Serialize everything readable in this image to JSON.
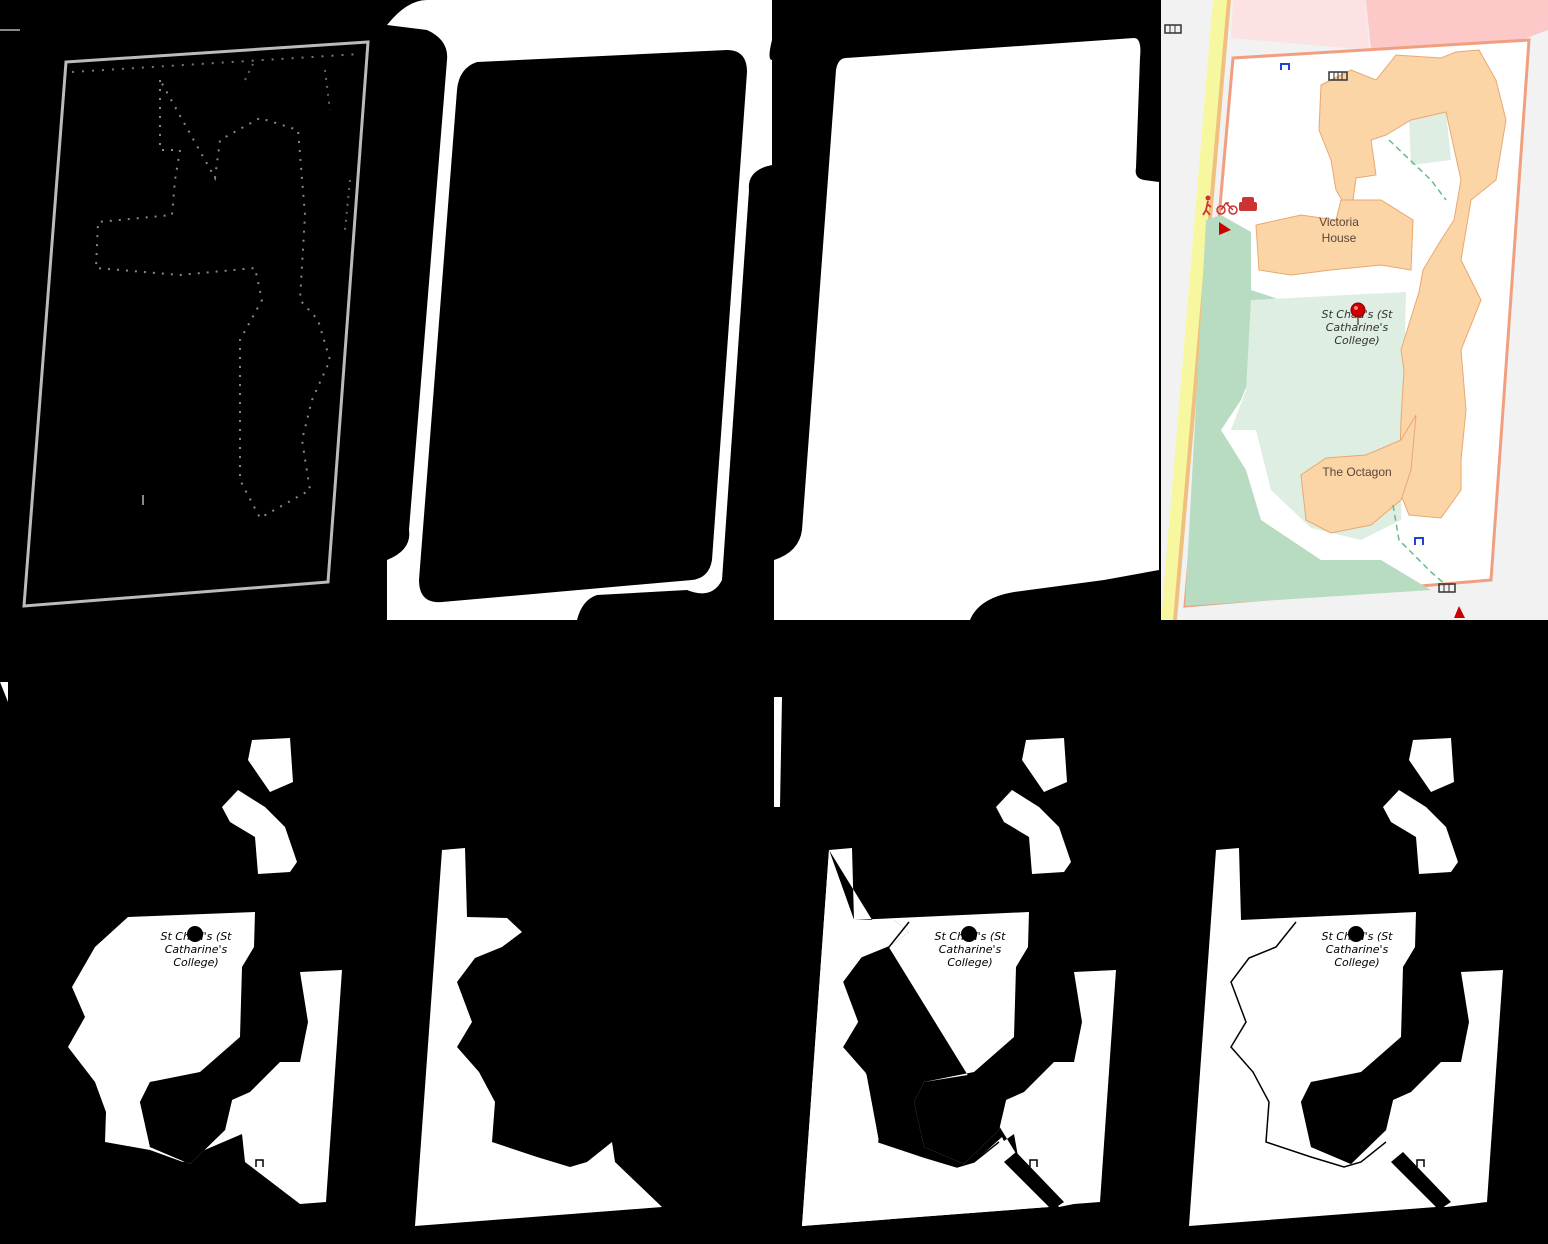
{
  "map": {
    "labels": {
      "victoria_line1": "Victoria",
      "victoria_line2": "House",
      "st_chads_line1": "St Chad's (St",
      "st_chads_line2": "Catharine's",
      "st_chads_line3": "College)",
      "octagon": "The Octagon"
    },
    "colors": {
      "building": "#fcd5a7",
      "building_outline": "#e8a870",
      "grass": "#b7dcc2",
      "lawn": "#dfeee2",
      "boundary": "#f0a080",
      "road": "#f7f7a0",
      "road_edge": "#f0c080",
      "background": "#f2f2f2",
      "pink_area": "#fcc8c8",
      "marker": "#cc0000"
    },
    "icons": [
      "fence-icon",
      "pedestrian-icon",
      "bicycle-icon",
      "car-icon",
      "parking-icon",
      "location-pin-icon",
      "triangle-marker-icon"
    ]
  },
  "mask_labels": {
    "line1": "St Chad's (St",
    "line2": "Catharine's",
    "line3": "College)"
  }
}
